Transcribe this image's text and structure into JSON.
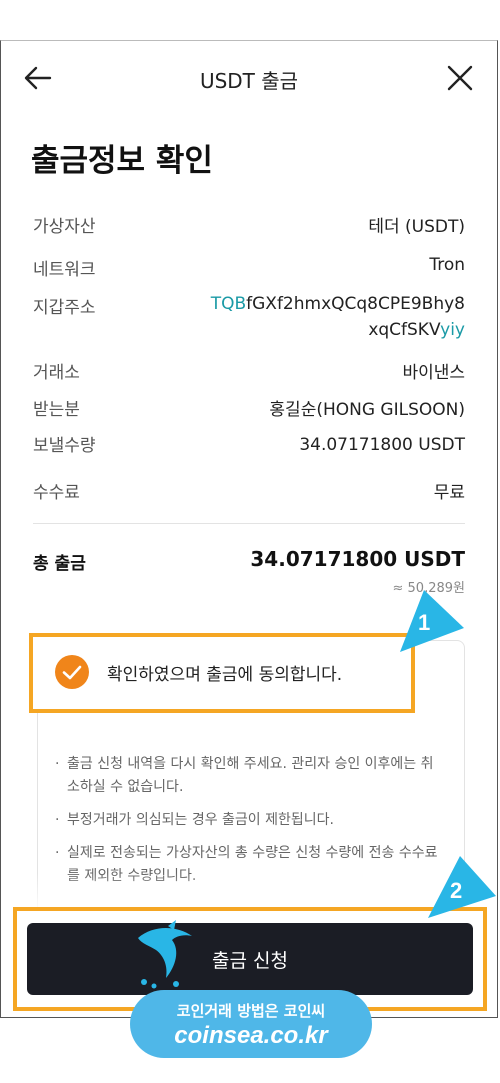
{
  "header": {
    "title": "USDT 출금"
  },
  "page_title": "출금정보 확인",
  "details": [
    {
      "label": "가상자산",
      "value": "테더 (USDT)"
    },
    {
      "label": "네트워크",
      "value": "Tron"
    },
    {
      "label": "지갑주소",
      "address_prefix": "TQB",
      "address_line1_rest": "fGXf2hmxQCq8CPE9Bhy8",
      "address_line2_main": "xqCfSKV",
      "address_suffix": "yiy"
    },
    {
      "label": "거래소",
      "value": "바이낸스"
    },
    {
      "label": "받는분",
      "value": "홍길순(HONG GILSOON)"
    },
    {
      "label": "보낼수량",
      "value": "34.07171800 USDT"
    },
    {
      "label": "수수료",
      "value": "무료"
    }
  ],
  "total": {
    "label": "총 출금",
    "value": "34.07171800 USDT",
    "krw": "≈ 50,289원"
  },
  "agree": {
    "text": "확인하였으며 출금에 동의합니다."
  },
  "notes": [
    "출금 신청 내역을 다시 확인해 주세요. 관리자 승인 이후에는 취소하실 수 없습니다.",
    "부정거래가 의심되는 경우 출금이 제한됩니다.",
    "실제로 전송되는 가상자산의 총 수량은 신청 수량에 전송 수수료를 제외한 수량입니다."
  ],
  "submit": {
    "label": "출금 신청"
  },
  "callouts": {
    "one": "1",
    "two": "2"
  },
  "watermark": {
    "line1": "코인거래 방법은 코인씨",
    "line2": "coinsea.co.kr"
  },
  "colors": {
    "accent": "#f0851a",
    "highlight": "#f5a623",
    "teal": "#1a9aa6",
    "callout": "#29b6e6",
    "button": "#1b1d25"
  }
}
